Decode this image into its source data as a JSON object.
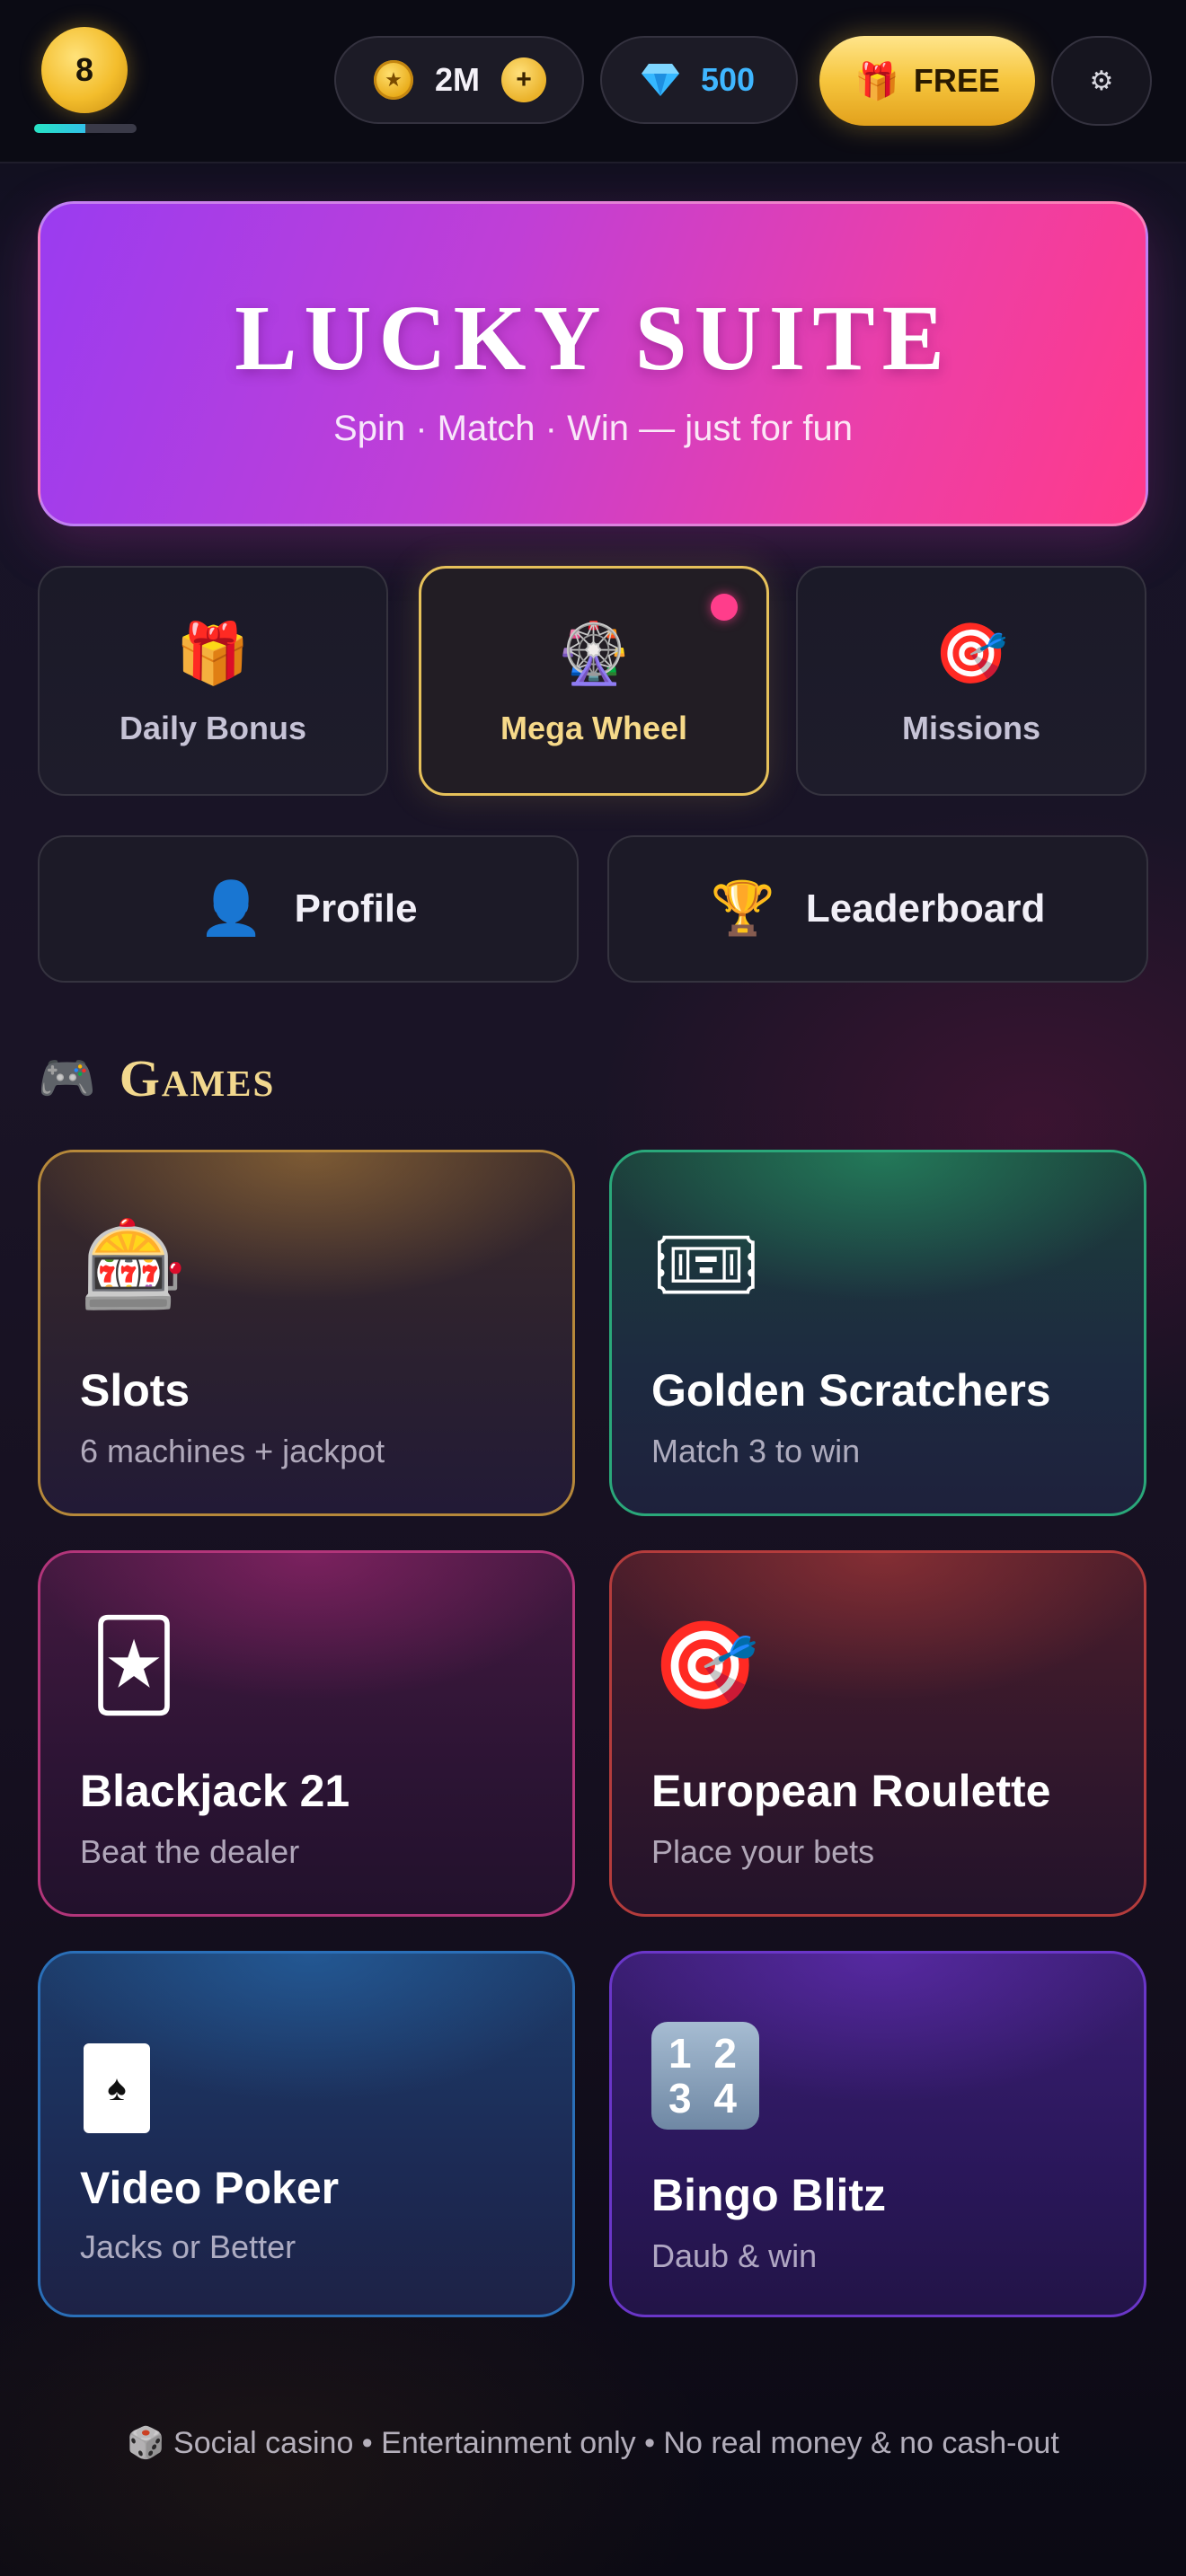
{
  "header": {
    "level": "8",
    "xp_progress": 0.5,
    "coins": "2M",
    "coin_add": "+",
    "gems": "500",
    "free_label": "FREE"
  },
  "hero": {
    "title": "LUCKY SUITE",
    "subtitle": "Spin · Match · Win — just for fun"
  },
  "quick_actions": [
    {
      "icon": "🎁",
      "label": "Daily Bonus"
    },
    {
      "icon": "🎡",
      "label": "Mega Wheel"
    },
    {
      "icon": "🎯",
      "label": "Missions"
    }
  ],
  "wide_buttons": [
    {
      "icon": "👤",
      "label": "Profile"
    },
    {
      "icon": "🏆",
      "label": "Leaderboard"
    }
  ],
  "section": {
    "icon": "🎮",
    "title": "Games"
  },
  "games": [
    {
      "icon": "🎰",
      "title": "Slots",
      "subtitle": "6 machines + jackpot"
    },
    {
      "icon": "🎟",
      "title": "Golden Scratchers",
      "subtitle": "Match 3 to win"
    },
    {
      "icon": "🃏",
      "title": "Blackjack 21",
      "subtitle": "Beat the dealer"
    },
    {
      "icon": "🎯",
      "title": "European Roulette",
      "subtitle": "Place your bets"
    },
    {
      "icon": "♠",
      "title": "Video Poker",
      "subtitle": "Jacks or Better"
    },
    {
      "icon": "1 2\n3 4",
      "title": "Bingo Blitz",
      "subtitle": "Daub & win"
    }
  ],
  "footer": {
    "icon": "🎲",
    "text": "Social casino • Entertainment only • No real money & no cash-out"
  },
  "colors": {
    "accent_gold": "#f3bd2c",
    "gem_blue": "#2fb4ff",
    "notification_pink": "#ff3d8b"
  }
}
